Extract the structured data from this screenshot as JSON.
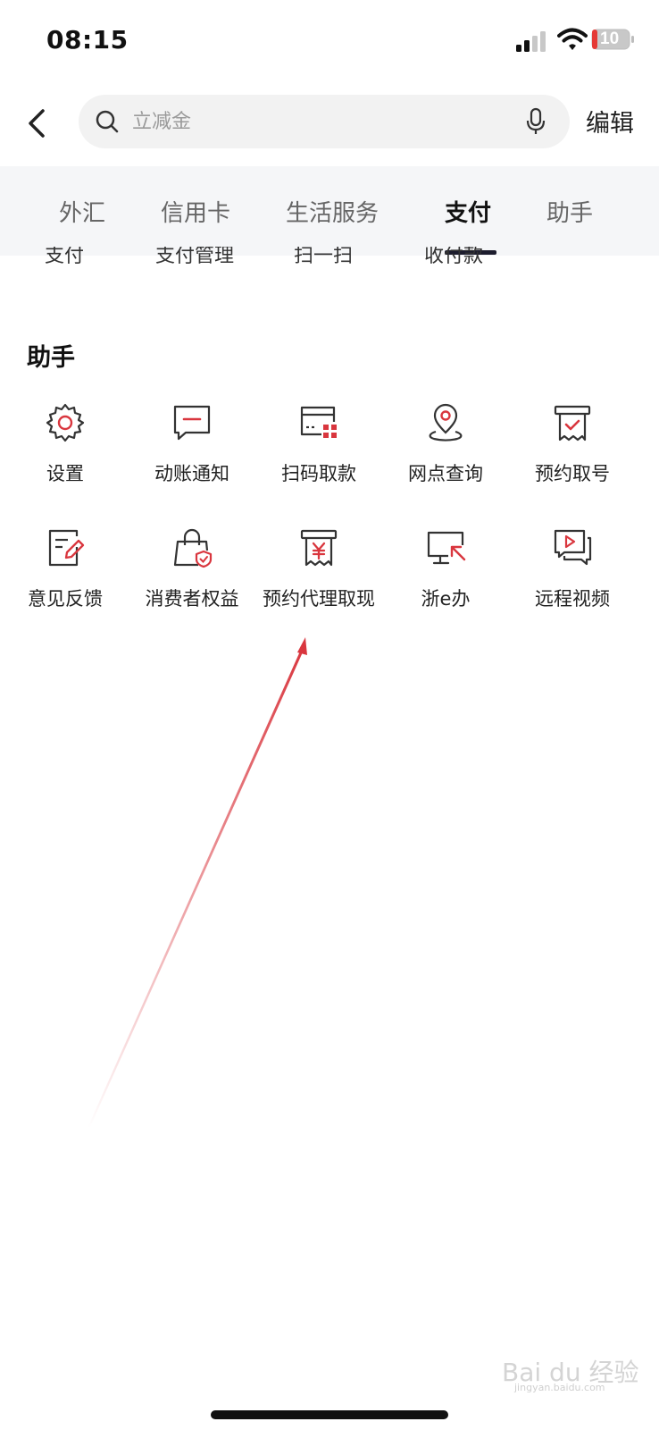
{
  "status": {
    "time": "08:15",
    "battery": "10"
  },
  "header": {
    "search_placeholder": "立减金",
    "edit_label": "编辑"
  },
  "tabs": [
    {
      "label": "外汇"
    },
    {
      "label": "信用卡"
    },
    {
      "label": "生活服务"
    },
    {
      "label": "支付",
      "active": true
    },
    {
      "label": "助手"
    }
  ],
  "partial_items": [
    "支付",
    "支付管理",
    "扫一扫",
    "收付款"
  ],
  "section": {
    "title": "助手",
    "items": [
      {
        "label": "设置",
        "icon": "gear-icon"
      },
      {
        "label": "动账通知",
        "icon": "message-icon"
      },
      {
        "label": "扫码取款",
        "icon": "qr-card-icon"
      },
      {
        "label": "网点查询",
        "icon": "location-pin-icon"
      },
      {
        "label": "预约取号",
        "icon": "ticket-icon"
      },
      {
        "label": "意见反馈",
        "icon": "feedback-icon"
      },
      {
        "label": "消费者权益",
        "icon": "shopping-bag-shield-icon"
      },
      {
        "label": "预约代理取现",
        "icon": "cash-receipt-icon"
      },
      {
        "label": "浙e办",
        "icon": "monitor-cursor-icon"
      },
      {
        "label": "远程视频",
        "icon": "video-chat-icon"
      }
    ]
  },
  "watermark": {
    "text": "Bai du 经验",
    "sub": "jingyan.baidu.com"
  },
  "colors": {
    "accent": "#d9363e",
    "icon_stroke": "#333333"
  }
}
